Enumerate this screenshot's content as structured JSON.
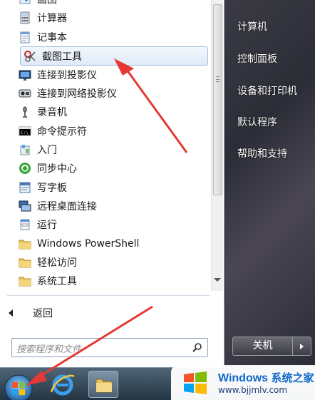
{
  "programs": [
    {
      "label": "画图",
      "icon": "paint-icon"
    },
    {
      "label": "计算器",
      "icon": "calculator-icon"
    },
    {
      "label": "记事本",
      "icon": "notepad-icon"
    },
    {
      "label": "截图工具",
      "icon": "snipping-tool-icon",
      "selected": true
    },
    {
      "label": "连接到投影仪",
      "icon": "projector-icon"
    },
    {
      "label": "连接到网络投影仪",
      "icon": "network-projector-icon"
    },
    {
      "label": "录音机",
      "icon": "microphone-icon"
    },
    {
      "label": "命令提示符",
      "icon": "command-prompt-icon"
    },
    {
      "label": "入门",
      "icon": "getting-started-icon"
    },
    {
      "label": "同步中心",
      "icon": "sync-center-icon"
    },
    {
      "label": "写字板",
      "icon": "wordpad-icon"
    },
    {
      "label": "远程桌面连接",
      "icon": "remote-desktop-icon"
    },
    {
      "label": "运行",
      "icon": "run-icon"
    },
    {
      "label": "Windows PowerShell",
      "icon": "folder-icon"
    },
    {
      "label": "轻松访问",
      "icon": "folder-icon"
    },
    {
      "label": "系统工具",
      "icon": "folder-icon"
    }
  ],
  "back_label": "返回",
  "search_placeholder": "搜索程序和文件",
  "right_menu": [
    "计算机",
    "控制面板",
    "设备和打印机",
    "默认程序",
    "帮助和支持"
  ],
  "shutdown_label": "关机",
  "watermark": {
    "brand": "Windows",
    "brand2": "系统之家",
    "url": "www.bjjmlv.com"
  },
  "colors": {
    "arrow": "#e53935",
    "selection_border": "#9dbde0",
    "right_pane": "#2f313a",
    "watermark_blue": "#0d67c8"
  }
}
